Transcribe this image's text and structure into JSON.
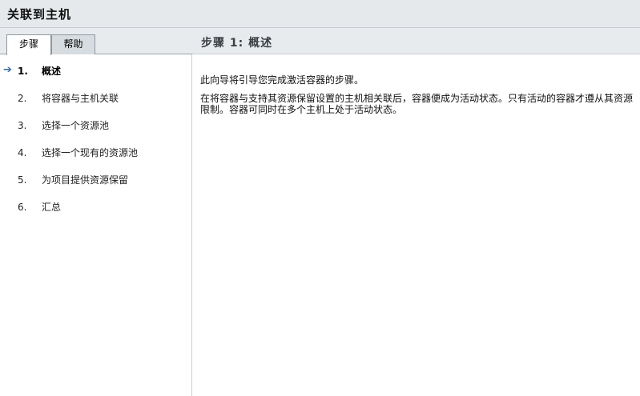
{
  "window": {
    "title": "关联到主机"
  },
  "tabs": [
    {
      "label": "步骤",
      "active": true
    },
    {
      "label": "帮助",
      "active": false
    }
  ],
  "steps": [
    {
      "number": "1.",
      "label": "概述",
      "current": true
    },
    {
      "number": "2.",
      "label": "将容器与主机关联",
      "current": false
    },
    {
      "number": "3.",
      "label": "选择一个资源池",
      "current": false
    },
    {
      "number": "4.",
      "label": "选择一个现有的资源池",
      "current": false
    },
    {
      "number": "5.",
      "label": "为项目提供资源保留",
      "current": false
    },
    {
      "number": "6.",
      "label": "汇总",
      "current": false
    }
  ],
  "current_step_icon": "right-arrow-icon",
  "panel": {
    "step_title": "步骤 1: 概述",
    "paragraphs": [
      "此向导将引导您完成激活容器的步骤。",
      "在将容器与支持其资源保留设置的主机相关联后，容器便成为活动状态。只有活动的容器才遵从其资源限制。容器可同时在多个主机上处于活动状态。"
    ]
  },
  "colors": {
    "header_bg": "#e5e9ec",
    "arrow": "#3a6ea5"
  }
}
